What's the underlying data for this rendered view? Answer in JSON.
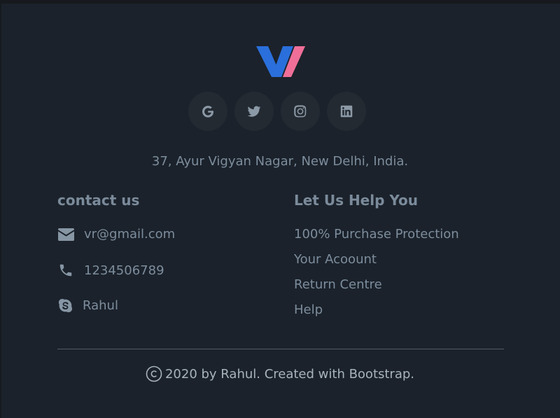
{
  "footer": {
    "social": [
      {
        "icon": "google-icon"
      },
      {
        "icon": "twitter-icon"
      },
      {
        "icon": "instagram-icon"
      },
      {
        "icon": "linkedin-icon"
      }
    ],
    "address": "37, Ayur Vigyan Nagar, New Delhi, India.",
    "contact": {
      "title": "contact us",
      "email": "vr@gmail.com",
      "phone": "1234506789",
      "skype": "Rahul"
    },
    "help": {
      "title": "Let Us Help You",
      "links": [
        "100% Purchase Protection",
        "Your Acoount",
        "Return Centre",
        "Help"
      ]
    },
    "copyright": "2020 by Rahul. Created with Bootstrap."
  },
  "colors": {
    "background": "#1b222b",
    "logo_blue": "#2a6fdb",
    "logo_pink": "#ef6f98",
    "text": "#7d8d9d"
  }
}
